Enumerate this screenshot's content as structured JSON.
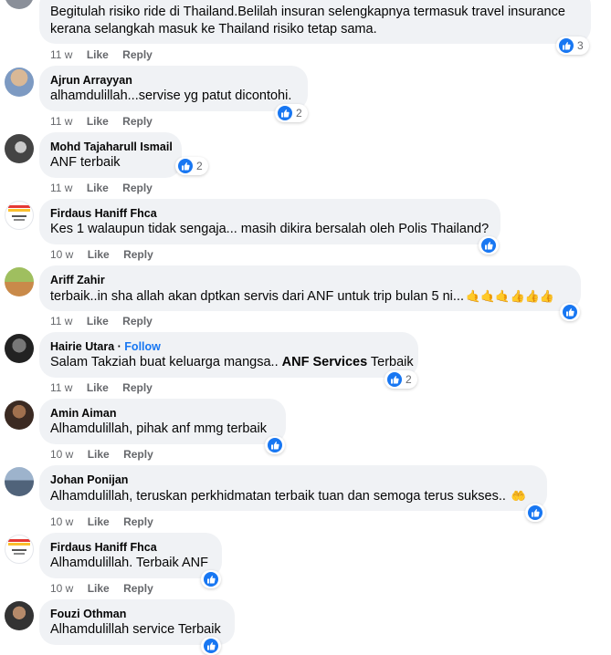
{
  "actions": {
    "like": "Like",
    "reply": "Reply",
    "follow": "Follow"
  },
  "comments": [
    {
      "name": "",
      "text": "Begitulah risiko ride di Thailand.Belilah insuran selengkapnya termasuk travel insurance",
      "text2": "kerana selangkah masuk ke Thailand risiko tetap sama.",
      "time": "11 w",
      "reactions": "3"
    },
    {
      "name": "Ajrun Arrayyan",
      "text": "alhamdulillah...servise yg patut dicontohi.",
      "time": "11 w",
      "reactions": "2"
    },
    {
      "name": "Mohd Tajaharull Ismail",
      "text": "ANF terbaik",
      "time": "11 w",
      "reactions": "2"
    },
    {
      "name": "Firdaus Haniff Fhca",
      "text": "Kes 1 walaupun tidak sengaja... masih dikira bersalah oleh Polis Thailand?",
      "time": "10 w",
      "reactions": ""
    },
    {
      "name": "Ariff Zahir",
      "text": "terbaik..in sha allah akan dptkan servis dari ANF untuk trip bulan 5 ni...",
      "emojis": "🤙🤙🤙👍👍👍",
      "time": "11 w",
      "reactions": ""
    },
    {
      "name": "Hairie Utara",
      "follow": "Follow",
      "text_before": "Salam Takziah buat keluarga mangsa.. ",
      "text_bold": "ANF Services",
      "text_after": " Terbaik",
      "time": "11 w",
      "reactions": "2"
    },
    {
      "name": "Amin Aiman",
      "text": "Alhamdulillah, pihak anf mmg terbaik",
      "time": "10 w",
      "reactions": ""
    },
    {
      "name": "Johan Ponijan",
      "text": "Alhamdulillah, teruskan perkhidmatan terbaik tuan dan semoga terus sukses..",
      "emojis": "🤲",
      "time": "10 w",
      "reactions": ""
    },
    {
      "name": "Firdaus Haniff Fhca",
      "text": "Alhamdulillah. Terbaik ANF",
      "time": "10 w",
      "reactions": ""
    },
    {
      "name": "Fouzi Othman",
      "text": "Alhamdulillah service Terbaik",
      "time": "",
      "reactions": ""
    }
  ],
  "colors": {
    "bubble": "#f0f2f5",
    "like_blue": "#1877f2",
    "meta_grey": "#65676b"
  }
}
